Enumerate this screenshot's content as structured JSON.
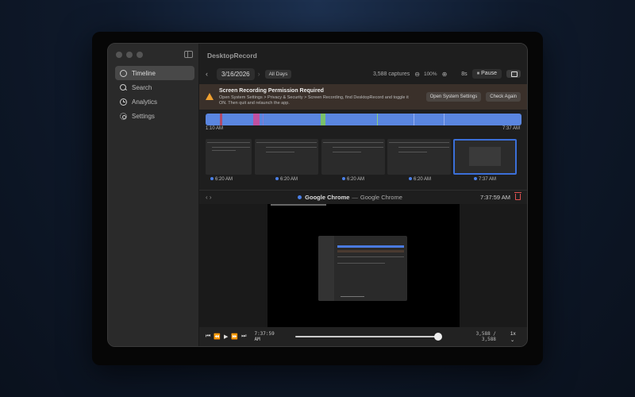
{
  "app": {
    "title": "DesktopRecord"
  },
  "sidebar": {
    "items": [
      {
        "label": "Timeline",
        "icon": "timeline-icon",
        "active": true
      },
      {
        "label": "Search",
        "icon": "search-icon",
        "active": false
      },
      {
        "label": "Analytics",
        "icon": "analytics-icon",
        "active": false
      },
      {
        "label": "Settings",
        "icon": "settings-icon",
        "active": false
      }
    ]
  },
  "toolbar": {
    "date": "3/16/2026",
    "all_days": "All Days",
    "captures": "3,588 captures",
    "zoom": "100%",
    "interval": "8s",
    "pause_label": "Pause"
  },
  "banner": {
    "title": "Screen Recording Permission Required",
    "body": "Open System Settings > Privacy & Security > Screen Recording, find DesktopRecord and toggle it ON. Then quit and relaunch the app.",
    "open_settings_label": "Open System Settings",
    "check_again_label": "Check Again"
  },
  "timeline": {
    "start_label": "1:10 AM",
    "end_label": "7:37 AM",
    "accent": "#5a86e0"
  },
  "thumbnails": [
    {
      "time": "6:20 AM",
      "selected": false
    },
    {
      "time": "6:20 AM",
      "selected": false
    },
    {
      "time": "6:20 AM",
      "selected": false
    },
    {
      "time": "6:20 AM",
      "selected": false
    },
    {
      "time": "7:37 AM",
      "selected": true
    }
  ],
  "detail": {
    "app_name": "Google Chrome",
    "separator": "—",
    "window_title": "Google Chrome",
    "time": "7:37:59 AM"
  },
  "player": {
    "current_time": "7:37:59 AM",
    "count": "3,588 / 3,588",
    "speed": "1x ⌄",
    "progress": 1.0
  }
}
